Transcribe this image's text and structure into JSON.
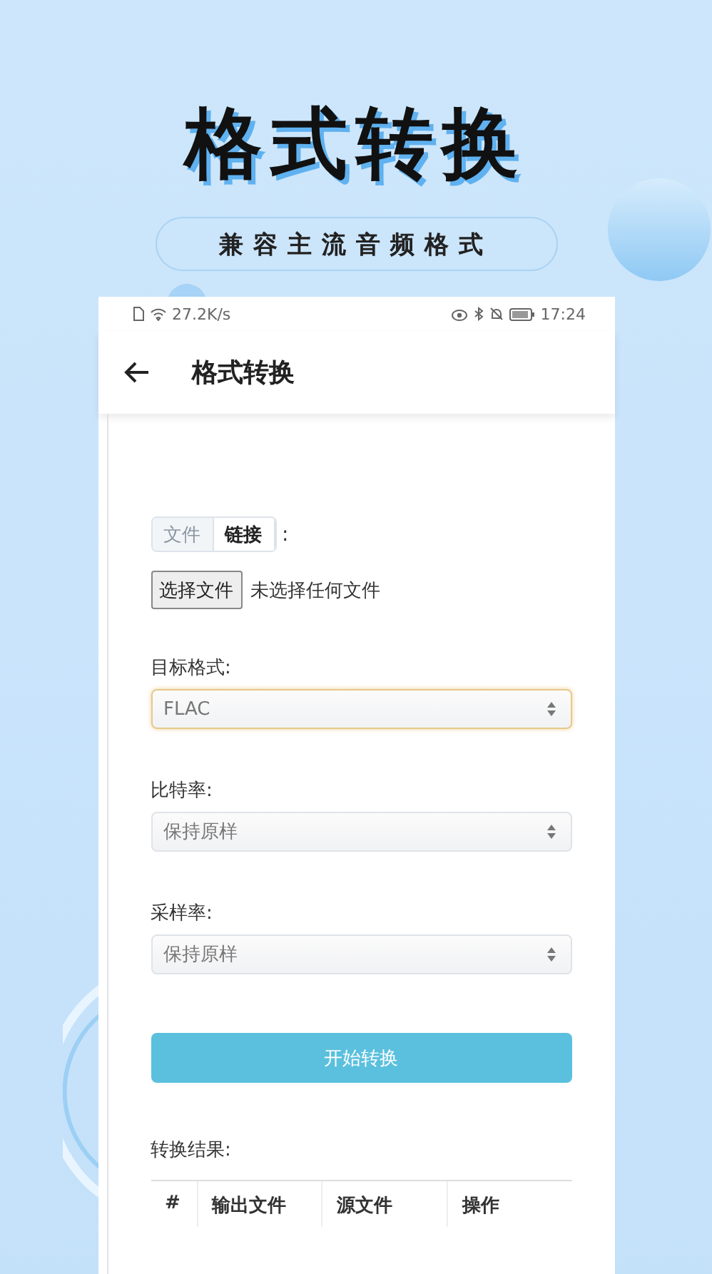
{
  "headline": "格式转换",
  "tagline": "兼容主流音频格式",
  "status_bar": {
    "speed": "27.2K/s",
    "time": "17:24"
  },
  "app_bar": {
    "title": "格式转换"
  },
  "source_tabs": [
    {
      "label": "文件",
      "selected": false
    },
    {
      "label": "链接",
      "selected": true
    }
  ],
  "source_colon": ":",
  "file_picker": {
    "button": "选择文件",
    "value": "未选择任何文件"
  },
  "fields": [
    {
      "label": "目标格式:",
      "value": "FLAC",
      "focused": true
    },
    {
      "label": "比特率:",
      "value": "保持原样",
      "focused": false
    },
    {
      "label": "采样率:",
      "value": "保持原样",
      "focused": false
    }
  ],
  "start_button": "开始转换",
  "results": {
    "label": "转换结果:",
    "columns": [
      "#",
      "输出文件",
      "源文件",
      "操作"
    ]
  }
}
